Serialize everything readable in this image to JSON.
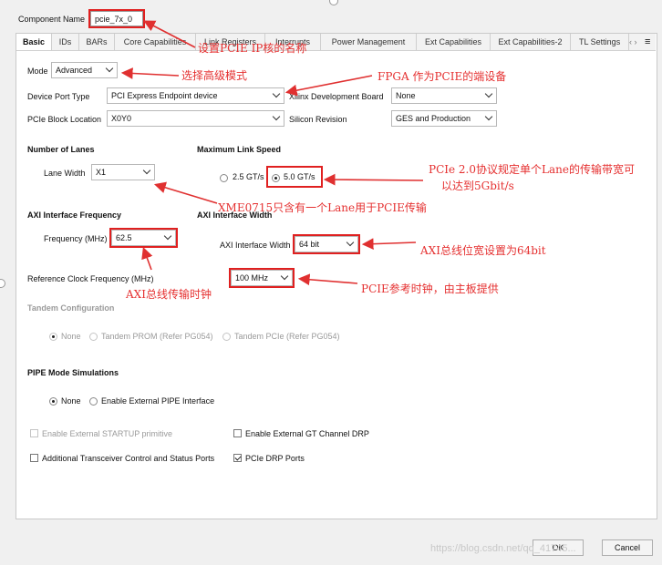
{
  "component": {
    "label": "Component Name",
    "value": "pcie_7x_0"
  },
  "tabs": [
    "Basic",
    "IDs",
    "BARs",
    "Core Capabilities",
    "Link Registers",
    "Interrupts",
    "Power Management",
    "Ext Capabilities",
    "Ext Capabilities-2",
    "TL Settings"
  ],
  "basic": {
    "mode_label": "Mode",
    "mode_value": "Advanced",
    "device_port_type_label": "Device Port Type",
    "device_port_type_value": "PCI Express Endpoint device",
    "xilinx_board_label": "Xilinx Development Board",
    "xilinx_board_value": "None",
    "block_location_label": "PCIe Block Location",
    "block_location_value": "X0Y0",
    "silicon_revision_label": "Silicon Revision",
    "silicon_revision_value": "GES and Production"
  },
  "lanes": {
    "header": "Number of Lanes",
    "label": "Lane Width",
    "value": "X1"
  },
  "link_speed": {
    "header": "Maximum Link Speed",
    "option_a": "2.5 GT/s",
    "option_b": "5.0 GT/s"
  },
  "axi_freq": {
    "header": "AXI Interface Frequency",
    "label": "Frequency (MHz)",
    "value": "62.5"
  },
  "axi_width": {
    "header": "AXI Interface Width",
    "label": "AXI Interface Width",
    "value": "64 bit"
  },
  "refclk": {
    "label": "Reference Clock Frequency (MHz)",
    "value": "100 MHz"
  },
  "tandem": {
    "header": "Tandem Configuration",
    "option_none": "None",
    "option_prom": "Tandem PROM (Refer PG054)",
    "option_pcie": "Tandem PCIe (Refer PG054)"
  },
  "pipe": {
    "header": "PIPE Mode Simulations",
    "option_none": "None",
    "option_ext": "Enable External PIPE Interface"
  },
  "checkboxes": {
    "startup": "Enable External STARTUP primitive",
    "gt_drp": "Enable External GT Channel DRP",
    "transceiver": "Additional Transceiver Control and Status Ports",
    "drp": "PCIe DRP Ports"
  },
  "buttons": {
    "ok": "OK",
    "cancel": "Cancel"
  },
  "annotations": {
    "name": "设置PCIE IP核的名称",
    "mode": "选择高级模式",
    "fpga": "FPGA 作为PCIE的端设备",
    "speed_1": "PCIe 2.0协议规定单个Lane的传输带宽可",
    "speed_2": "以达到5Gbit/s",
    "lane": "XME0715只含有一个Lane用于PCIE传输",
    "width": "AXI总线位宽设置为64bit",
    "clock": "AXI总线传输时钟",
    "refclk": "PCIE参考时钟，由主板提供"
  },
  "watermark": "https://blog.csdn.net/qq_41745..."
}
